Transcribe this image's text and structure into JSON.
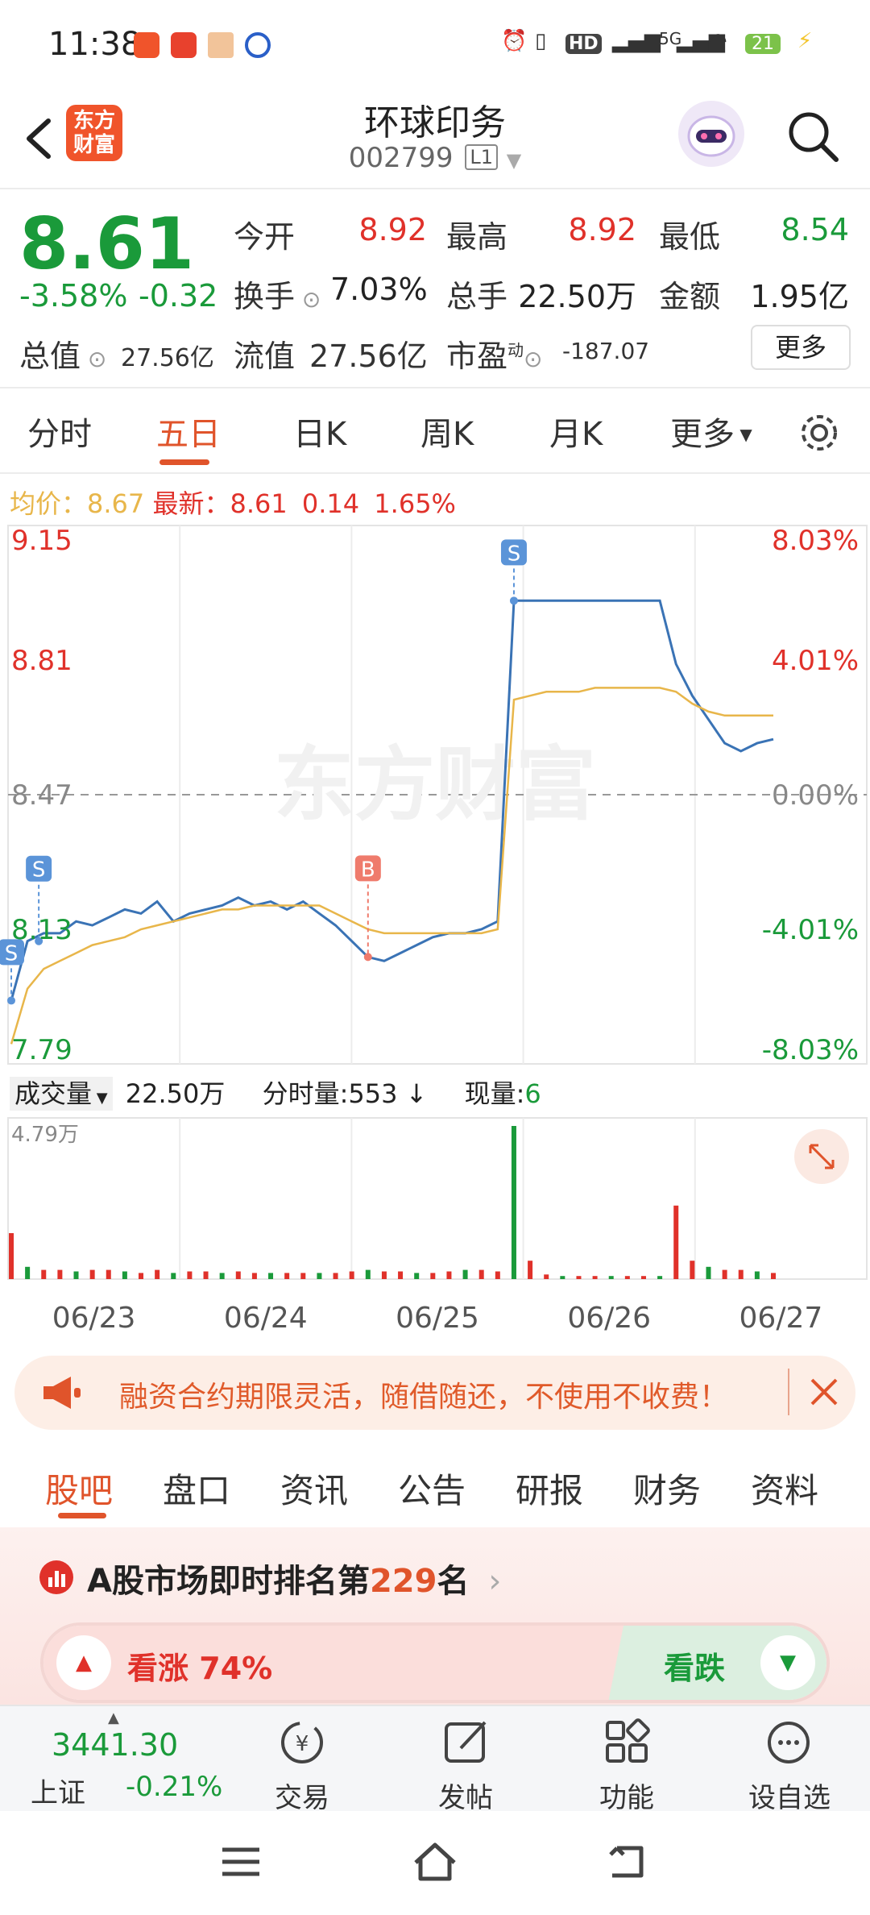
{
  "status_bar": {
    "time": "11:38",
    "hd_label": "HD",
    "network": "5G",
    "battery": "21"
  },
  "header": {
    "back_icon": "chevron-left-icon",
    "logo_text": "东方\n财富",
    "stock_name": "环球印务",
    "stock_code": "002799",
    "level_badge": "L1"
  },
  "quote": {
    "price": "8.61",
    "change_pct": "-3.58%",
    "change_abs": "-0.32",
    "open_label": "今开",
    "open": "8.92",
    "high_label": "最高",
    "high": "8.92",
    "low_label": "最低",
    "low": "8.54",
    "turnover_label": "换手",
    "turnover": "7.03%",
    "volume_label": "总手",
    "volume": "22.50万",
    "amount_label": "金额",
    "amount": "1.95亿",
    "mktcap_label": "总值",
    "mktcap": "27.56亿",
    "float_label": "流值",
    "float": "27.56亿",
    "pe_label": "市盈",
    "pe_sup": "动",
    "pe": "-187.07",
    "more_button": "更多"
  },
  "period_tabs": {
    "items": [
      "分时",
      "五日",
      "日K",
      "周K",
      "月K",
      "更多"
    ],
    "active": "五日"
  },
  "chart_info": {
    "avg_label": "均价：",
    "avg": "8.67",
    "latest_label": "最新：",
    "latest": "8.61",
    "change": "0.14",
    "change_pct": "1.65%"
  },
  "chart_data": {
    "type": "line",
    "watermark": "东方财富",
    "price_axis": [
      "9.15",
      "8.81",
      "8.47",
      "8.13",
      "7.79"
    ],
    "pct_axis": [
      "8.03%",
      "4.01%",
      "0.00%",
      "-4.01%",
      "-8.03%"
    ],
    "x_labels": [
      "06/23",
      "06/24",
      "06/25",
      "06/26",
      "06/27"
    ],
    "ylim": [
      7.79,
      9.15
    ],
    "prev_close": 8.47,
    "series": [
      {
        "name": "最新",
        "values": [
          7.95,
          8.1,
          8.12,
          8.12,
          8.15,
          8.14,
          8.16,
          8.18,
          8.17,
          8.2,
          8.15,
          8.17,
          8.18,
          8.19,
          8.21,
          8.19,
          8.2,
          8.18,
          8.2,
          8.17,
          8.14,
          8.1,
          8.06,
          8.05,
          8.07,
          8.09,
          8.11,
          8.12,
          8.12,
          8.13,
          8.15,
          8.96,
          8.96,
          8.96,
          8.96,
          8.96,
          8.96,
          8.96,
          8.96,
          8.96,
          8.96,
          8.8,
          8.72,
          8.66,
          8.6,
          8.58,
          8.6,
          8.61
        ]
      },
      {
        "name": "均价",
        "values": [
          7.84,
          7.98,
          8.03,
          8.05,
          8.07,
          8.09,
          8.1,
          8.11,
          8.13,
          8.14,
          8.15,
          8.16,
          8.17,
          8.18,
          8.18,
          8.19,
          8.19,
          8.19,
          8.19,
          8.19,
          8.17,
          8.15,
          8.13,
          8.12,
          8.12,
          8.12,
          8.12,
          8.12,
          8.12,
          8.12,
          8.13,
          8.71,
          8.72,
          8.73,
          8.73,
          8.73,
          8.74,
          8.74,
          8.74,
          8.74,
          8.74,
          8.73,
          8.7,
          8.68,
          8.67,
          8.67,
          8.67,
          8.67
        ]
      }
    ],
    "markers": [
      {
        "label": "S",
        "type": "sell",
        "index": 0
      },
      {
        "label": "S",
        "type": "sell",
        "index": 1
      },
      {
        "label": "B",
        "type": "buy",
        "index": 22
      },
      {
        "label": "S",
        "type": "sell",
        "index": 31
      }
    ],
    "volume": {
      "label": "成交量",
      "total": "22.50万",
      "minute_label": "分时量:553",
      "current_label": "现量:",
      "current": "6",
      "max_label": "4.79万",
      "bars": [
        0.3,
        0.08,
        0.06,
        0.06,
        0.05,
        0.06,
        0.06,
        0.05,
        0.04,
        0.06,
        0.04,
        0.05,
        0.05,
        0.04,
        0.05,
        0.04,
        0.04,
        0.04,
        0.04,
        0.04,
        0.04,
        0.05,
        0.06,
        0.05,
        0.05,
        0.04,
        0.04,
        0.05,
        0.06,
        0.06,
        0.05,
        1.0,
        0.12,
        0.03,
        0.02,
        0.02,
        0.02,
        0.02,
        0.02,
        0.02,
        0.02,
        0.48,
        0.12,
        0.08,
        0.06,
        0.06,
        0.05,
        0.04
      ]
    }
  },
  "ad_banner": {
    "icon": "megaphone-icon",
    "text": "融资合约期限灵活，随借随还，不使用不收费！",
    "close_icon": "close-icon"
  },
  "section_tabs": {
    "items": [
      "股吧",
      "盘口",
      "资讯",
      "公告",
      "研报",
      "财务",
      "资料"
    ],
    "active": "股吧"
  },
  "rank": {
    "text_prefix": "A股市场即时排名第",
    "rank": "229",
    "text_suffix": "名",
    "bull_label": "看涨",
    "bull_pct": "74%",
    "bear_label": "看跌"
  },
  "bottom_bar": {
    "index_value": "3441.30",
    "index_name": "上证",
    "index_change": "-0.21%",
    "items": [
      "交易",
      "发帖",
      "功能",
      "设自选"
    ]
  },
  "colors": {
    "accent": "#e0542b",
    "up": "#e0312a",
    "down": "#1a9a3a",
    "price_line": "#3a73b5",
    "avg_line": "#e8b64a"
  }
}
